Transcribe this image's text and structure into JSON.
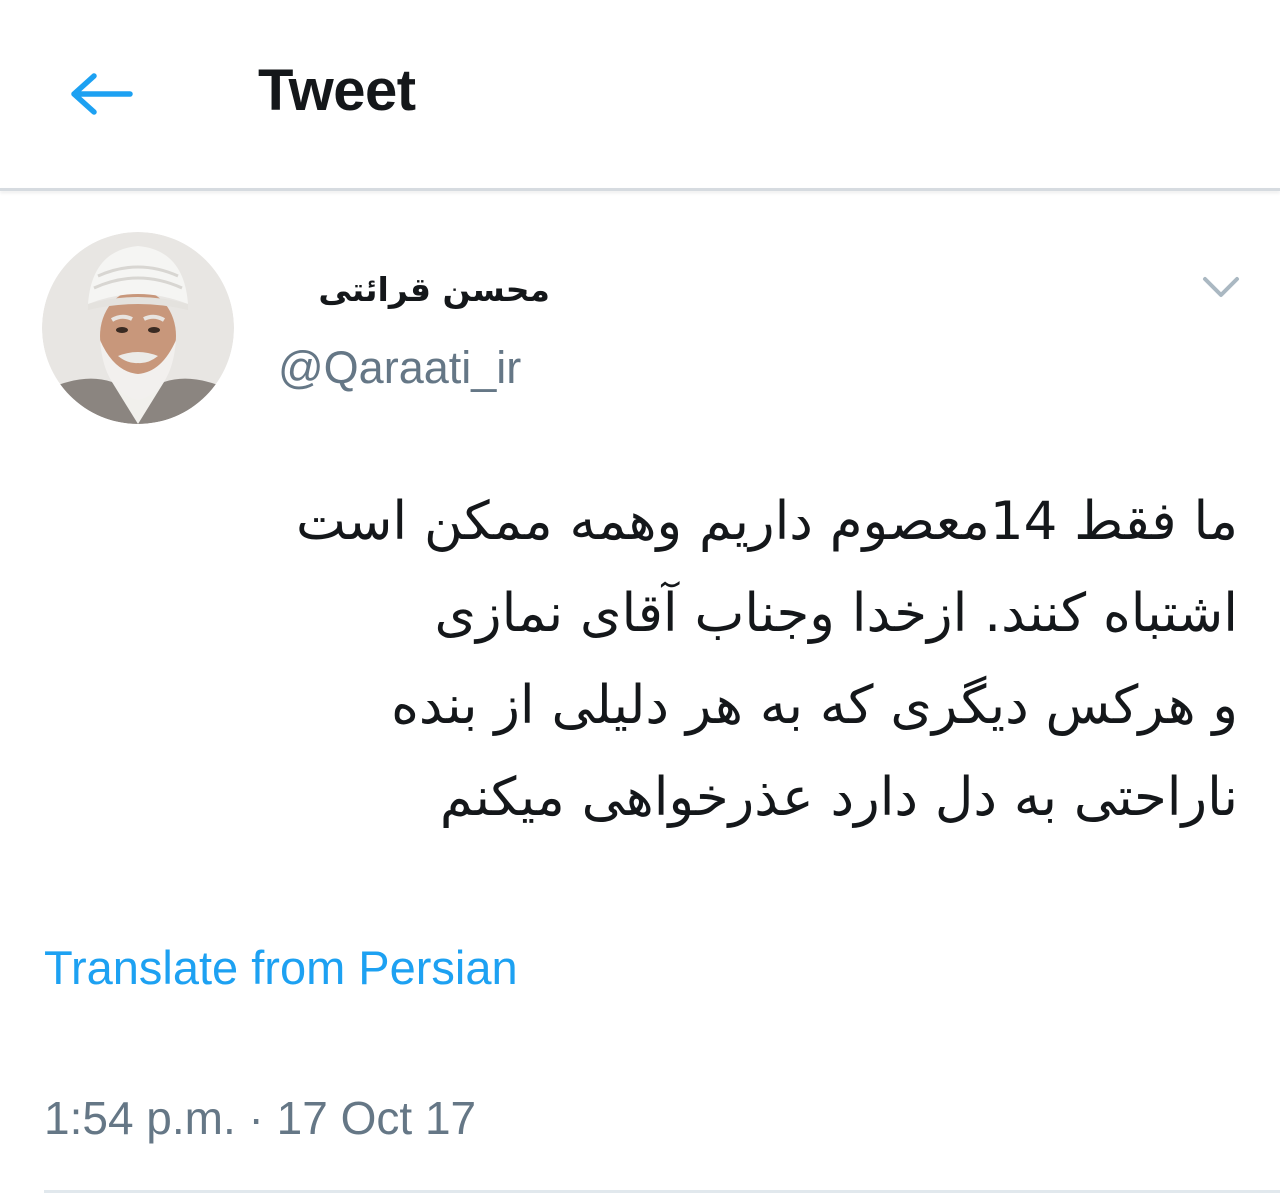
{
  "header": {
    "title": "Tweet",
    "back_icon": "arrow-left-icon",
    "accent_color": "#1da1f2"
  },
  "tweet": {
    "author": {
      "display_name": "محسن قرائتی",
      "handle": "@Qaraati_ir",
      "avatar_icon": "avatar-photo"
    },
    "menu_icon": "chevron-down-icon",
    "text_lines": [
      "ما فقط 14معصوم داریم وهمه ممکن است",
      "اشتباه کنند. ازخدا وجناب آقای نمازی",
      "و هرکس دیگری که به هر دلیلی از بنده",
      "ناراحتی به دل دارد عذرخواهی میکنم"
    ],
    "translate_label": "Translate from Persian",
    "timestamp": "1:54 p.m. · 17 Oct 17"
  }
}
